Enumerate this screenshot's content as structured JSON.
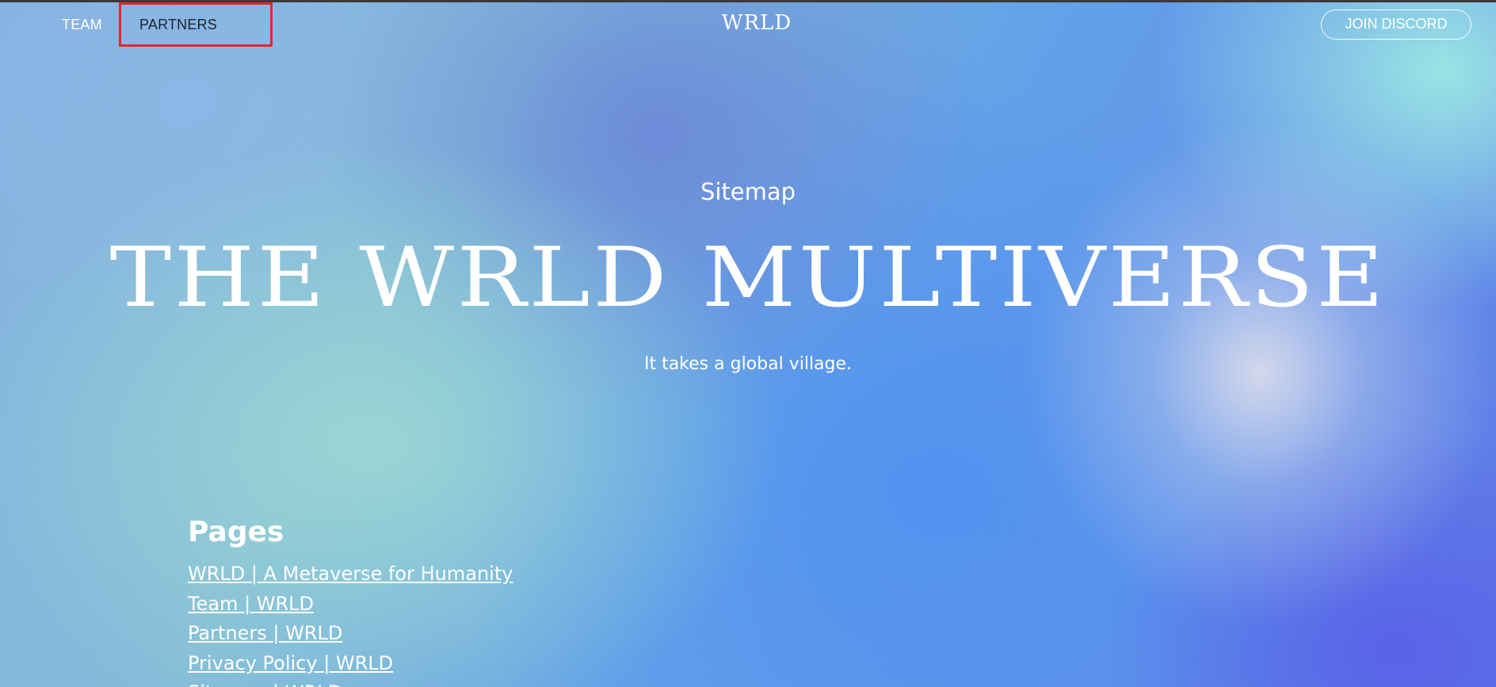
{
  "nav": {
    "team_label": "TEAM",
    "partners_label": "PARTNERS",
    "logo_text": "WRLD",
    "join_label": "JOIN DISCORD"
  },
  "hero": {
    "eyebrow": "Sitemap",
    "headline": "THE WRLD MULTIVERSE",
    "tagline": "It takes a global village."
  },
  "pages": {
    "heading": "Pages",
    "links": [
      "WRLD | A Metaverse for Humanity",
      "Team | WRLD",
      "Partners | WRLD",
      "Privacy Policy | WRLD",
      "Sitemap | WRLD"
    ]
  },
  "colors": {
    "highlight": "#e5262b",
    "text_light": "#ffffff",
    "text_dark": "#1c2330"
  }
}
